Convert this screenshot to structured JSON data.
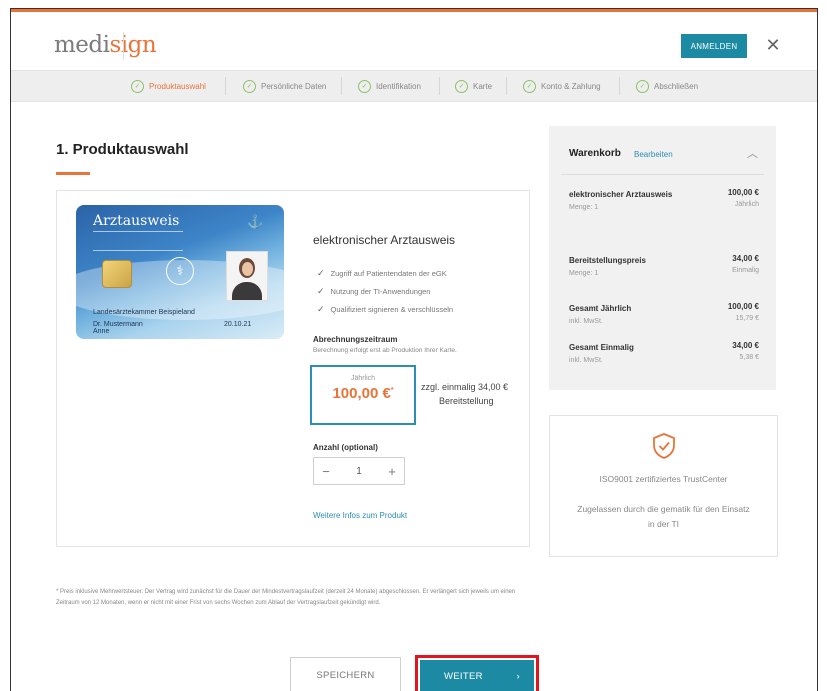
{
  "header": {
    "logo_prefix": "medi",
    "logo_accent": "sign",
    "login_label": "ANMELDEN",
    "close_icon": "✕"
  },
  "steps": [
    {
      "label": "Produktauswahl",
      "state": "active"
    },
    {
      "label": "Persönliche Daten",
      "state": "pending"
    },
    {
      "label": "Identifikation",
      "state": "pending"
    },
    {
      "label": "Karte",
      "state": "pending"
    },
    {
      "label": "Konto & Zahlung",
      "state": "pending"
    },
    {
      "label": "Abschließen",
      "state": "pending"
    }
  ],
  "page_title": "1. Produktauswahl",
  "product": {
    "card_title": "Arztausweis",
    "card_name_line1": "Landesärztekammer Beispieland",
    "card_name_line2": "Dr. Mustermann",
    "card_first_name": "Anne",
    "card_date": "20.10.21",
    "name": "elektronischer Arztausweis",
    "features": [
      "Zugriff auf Patientendaten der eGK",
      "Nutzung der TI-Anwendungen",
      "Qualifiziert signieren & verschlüsseln"
    ],
    "billing_label": "Abrechnungszeitraum",
    "billing_sub": "Berechnung erfolgt erst ab Produktion Ihrer Karte.",
    "price_period": "Jährlich",
    "price_amount": "100,00 €",
    "price_mark": "*",
    "extra_line1": "zzgl. einmalig 34,00 €",
    "extra_line2": "Bereitstellung",
    "qty_label": "Anzahl (optional)",
    "qty_minus": "−",
    "qty_value": "1",
    "qty_plus": "+",
    "more_info": "Weitere Infos zum Produkt"
  },
  "cart": {
    "title": "Warenkorb",
    "edit": "Bearbeiten",
    "chevron": "︿",
    "items": [
      {
        "name": "elektronischer Arztausweis",
        "sub": "Menge: 1",
        "price": "100,00 €",
        "note": "Jährlich"
      },
      {
        "name": "Bereitstellungspreis",
        "sub": "Menge: 1",
        "price": "34,00 €",
        "note": "Einmalig"
      },
      {
        "name": "Gesamt Jährlich",
        "sub": "inkl. MwSt.",
        "price": "100,00 €",
        "note": "15,79 €"
      },
      {
        "name": "Gesamt Einmalig",
        "sub": "inkl. MwSt.",
        "price": "34,00 €",
        "note": "5,38 €"
      }
    ]
  },
  "trust": {
    "cert": "ISO9001 zertifiziertes TrustCenter",
    "approval": "Zugelassen durch die gematik für den Einsatz in der TI"
  },
  "footnote": "* Preis inklusive Mehrwertsteuer. Der Vertrag wird zunächst für die Dauer der Mindestvertragslaufzeit (derzeit 24 Monate) abgeschlossen. Er verlängert sich jeweils um einen Zeitraum von 12 Monaten, wenn er nicht mit einer Frist von sechs Wochen zum Ablauf der Vertragslaufzeit gekündigt wird.",
  "actions": {
    "save": "SPEICHERN",
    "next": "WEITER",
    "next_arrow": "›"
  },
  "colors": {
    "accent": "#e9743a",
    "primary": "#1d8aa3",
    "highlight": "#e0161e"
  }
}
